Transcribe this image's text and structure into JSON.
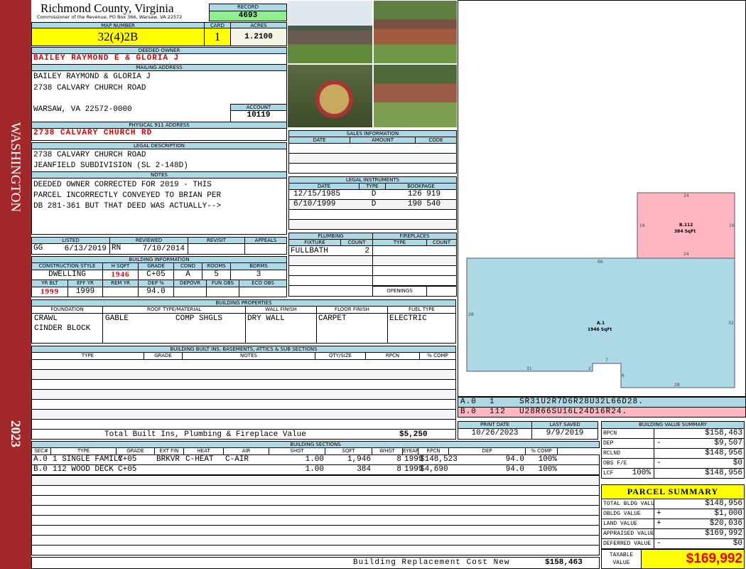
{
  "side": {
    "district": "WASHINGTON",
    "year": "2023"
  },
  "header": {
    "county": "Richmond County, Virginia",
    "office": "Commissioner of the Revenue, PO Box 366, Warsaw, VA 22572",
    "record_label": "RECORD",
    "record": "4693",
    "map_label": "MAP NUMBER",
    "map": "32(4)2B",
    "card_label": "CARD",
    "card": "1",
    "acres_label": "ACRES",
    "acres": "1.2100"
  },
  "owner": {
    "label": "DEEDED OWNER",
    "name": "BAILEY RAYMOND E & GLORIA J"
  },
  "mailing": {
    "label": "MAILING ADDRESS",
    "lines": [
      "BAILEY RAYMOND & GLORIA J",
      "2738 CALVARY CHURCH ROAD",
      "WARSAW, VA 22572-0000"
    ],
    "account_label": "ACCOUNT",
    "account": "10119"
  },
  "physical": {
    "label": "PHYSICAL 911 ADDRESS",
    "address": "2738 CALVARY CHURCH RD"
  },
  "legal": {
    "label": "LEGAL DESCRIPTION",
    "lines": [
      "2738 CALVARY CHURCH ROAD",
      "JEANFIELD SUBDIVISION (SL 2-148D)"
    ]
  },
  "notes": {
    "label": "NOTES",
    "lines": [
      "DEEDED OWNER CORRECTED FOR 2019 - THIS",
      "PARCEL INCORRECTLY CONVEYED TO BRIAN PER",
      "DB 281-361 BUT THAT DEED WAS ACTUALLY-->"
    ]
  },
  "review": {
    "headers": [
      "LISTED",
      "REVIEWED",
      "REVISIT",
      "APPEALS"
    ],
    "listed_by": "GG",
    "listed": "6/13/2019",
    "reviewed_by": "RN",
    "reviewed": "7/10/2014"
  },
  "building_info": {
    "label": "BUILDING INFORMATION",
    "h1": [
      "CONSTRUCTION STYLE",
      "H SQFT",
      "GRADE",
      "COND",
      "ROOMS",
      "BDRMS"
    ],
    "v1": [
      "DWELLING",
      "1946",
      "C+05",
      "A",
      "5",
      "3"
    ],
    "h2": [
      "YR BLT",
      "EFF YR",
      "REM YR",
      "DEP %",
      "DEPOVR",
      "FUN OBS",
      "ECO OBS"
    ],
    "v2": [
      "1999",
      "1999",
      "",
      "94.0",
      "",
      "",
      ""
    ]
  },
  "sales": {
    "label": "SALES INFORMATION",
    "headers": [
      "DATE",
      "AMOUNT",
      "CODE"
    ]
  },
  "instruments": {
    "label": "LEGAL INSTRUMENTS",
    "headers": [
      "DATE",
      "TYPE",
      "BOOKPAGE"
    ],
    "rows": [
      [
        "12/15/1985",
        "D",
        "126 919"
      ],
      [
        "6/10/1999",
        "D",
        "190 540"
      ]
    ]
  },
  "plumbing": {
    "label": "PLUMBING",
    "headers": [
      "FIXTURE",
      "COUNT"
    ],
    "rows": [
      [
        "FULLBATH",
        "2"
      ]
    ]
  },
  "fireplaces": {
    "label": "FIREPLACES",
    "headers": [
      "TYPE",
      "COUNT"
    ],
    "openings": "OPENINGS"
  },
  "properties": {
    "label": "BUILDING PROPERTIES",
    "headers": [
      "FOUNDATION",
      "ROOF TYPE/MATERIAL",
      "WALL FINISH",
      "FLOOR FINISH",
      "FUEL TYPE"
    ],
    "foundation": [
      "CRAWL",
      "CINDER BLOCK"
    ],
    "roof_type": "GABLE",
    "roof_material": "COMP SHGLS",
    "wall": "DRY WALL",
    "floor": "CARPET",
    "fuel": "ELECTRIC"
  },
  "builtins": {
    "label": "BUILDING BUILT INS, BASEMENTS, ATTICS & SUB SECTIONS",
    "headers": [
      "TYPE",
      "GRADE",
      "NOTES",
      "QTY/SIZE",
      "RPCN",
      "% COMP"
    ],
    "total_label": "Total Built Ins, Plumbing & Fireplace Value",
    "total": "$5,250"
  },
  "sections": {
    "label": "BUILDING SECTIONS",
    "headers": [
      "SEC#",
      "TYPE",
      "GRADE",
      "EXT FIN",
      "HEAT",
      "AIR",
      "SHGT",
      "SQFT",
      "WHGT",
      "EYEAR",
      "RPCN",
      "DEP",
      "% COMP"
    ],
    "rows": [
      [
        "A.0",
        "1 SINGLE FAMILY",
        "C+05",
        "BRKVR",
        "C-HEAT",
        "C-AIR",
        "1.00",
        "1,946",
        "8",
        "1999",
        "$148,523",
        "94.0",
        "100%"
      ],
      [
        "B.0",
        "112 WOOD DECK",
        "C+05",
        "",
        "",
        "",
        "1.00",
        "384",
        "8",
        "1999",
        "$4,690",
        "94.0",
        "100%"
      ]
    ],
    "replacement_label": "Building Replacement Cost New",
    "replacement": "$158,463"
  },
  "sketch": {
    "a_label": "A.1",
    "a_area": "1946 SqFt",
    "b_label": "B.112",
    "b_area": "384 SqFt",
    "dims": {
      "a_top": "66",
      "a_left": "28",
      "a_right": "32",
      "a_bottom_left": "31",
      "a_notch_left": "2",
      "a_notch_top": "7",
      "a_notch_right": "6",
      "a_bottom_right": "28",
      "b_top": "24",
      "b_bottom": "24",
      "b_left": "16",
      "b_right": "16"
    },
    "codes": [
      [
        "A.0",
        "1",
        "SR31U2R7D6R28U32L66D28."
      ],
      [
        "B.0",
        "112",
        "U28R66SU16L24D16R24."
      ]
    ]
  },
  "dates": {
    "print_label": "PRINT DATE",
    "print": "10/26/2023",
    "saved_label": "LAST SAVED",
    "saved": "9/9/2019"
  },
  "value_summary": {
    "label": "BUILDING VALUE SUMMARY",
    "rows": [
      [
        "RPCN",
        "",
        "$158,463"
      ],
      [
        "DEP",
        "-",
        "$9,507"
      ],
      [
        "RCLND",
        "",
        "$148,956"
      ],
      [
        "OBS F/E",
        "-",
        "$0"
      ],
      [
        "LCF",
        "",
        "$148,956"
      ]
    ],
    "lcf_pct": "100%"
  },
  "parcel": {
    "label": "PARCEL SUMMARY",
    "rows": [
      [
        "TOTAL BLDG VALUE",
        "",
        "$148,956"
      ],
      [
        "OBLDG VALUE",
        "+",
        "$1,000"
      ],
      [
        "LAND VALUE",
        "+",
        "$20,036"
      ],
      [
        "APPRAISED VALUE",
        "",
        "$169,992"
      ],
      [
        "DEFERRED VALUE",
        "-",
        "$0"
      ]
    ],
    "taxable_label": "TAXABLE VALUE",
    "taxable": "$169,992"
  }
}
